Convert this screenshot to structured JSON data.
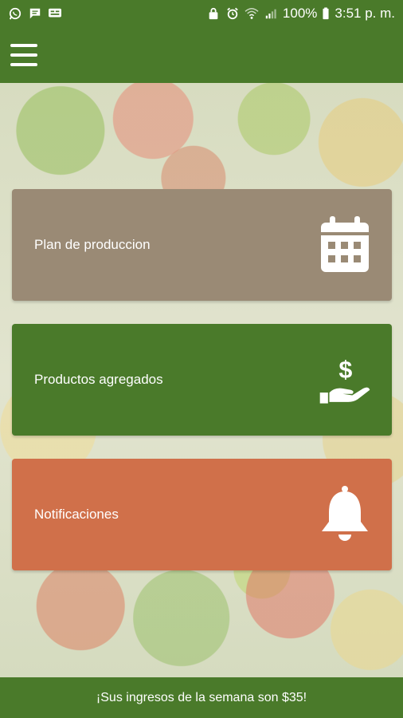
{
  "status_bar": {
    "battery": "100%",
    "time": "3:51 p. m."
  },
  "colors": {
    "primary_green": "#4a7a2a",
    "card_plan": "#9a8a75",
    "card_productos": "#4a7a2a",
    "card_notificaciones": "#d0704a"
  },
  "menu": {
    "icon": "hamburger-menu-icon"
  },
  "cards": [
    {
      "label": "Plan de produccion",
      "icon": "calendar-icon"
    },
    {
      "label": "Productos agregados",
      "icon": "hand-dollar-icon"
    },
    {
      "label": "Notificaciones",
      "icon": "bell-icon"
    }
  ],
  "footer": {
    "text": "¡Sus ingresos de la semana son $35!"
  }
}
